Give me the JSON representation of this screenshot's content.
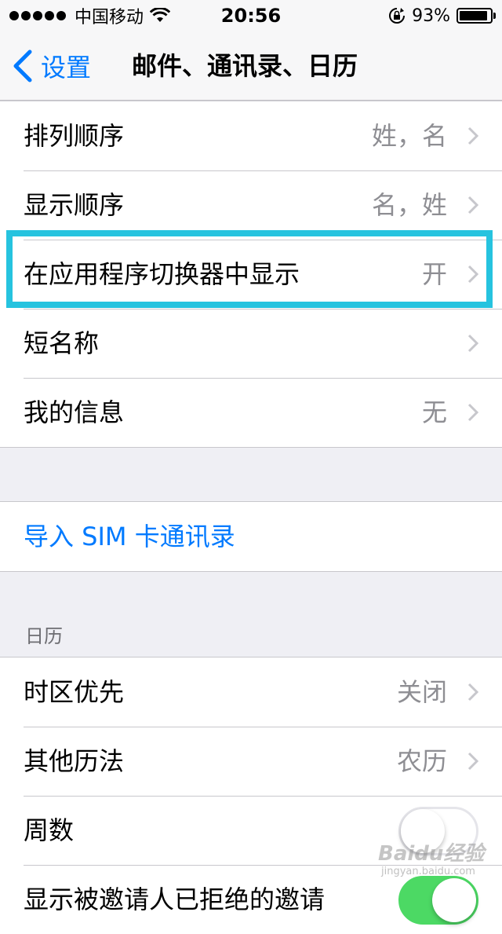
{
  "status_bar": {
    "carrier": "中国移动",
    "time": "20:56",
    "battery_percent": "93%",
    "battery_level": 0.93,
    "icons": [
      "signal-dots-icon",
      "wifi-icon",
      "rotation-lock-icon",
      "battery-icon"
    ]
  },
  "nav": {
    "back_label": "设置",
    "title": "邮件、通讯录、日历"
  },
  "contacts": {
    "rows": [
      {
        "label": "排列顺序",
        "value": "姓，名"
      },
      {
        "label": "显示顺序",
        "value": "名，姓"
      },
      {
        "label": "在应用程序切换器中显示",
        "value": "开"
      },
      {
        "label": "短名称",
        "value": ""
      },
      {
        "label": "我的信息",
        "value": "无"
      }
    ]
  },
  "import": {
    "label": "导入 SIM 卡通讯录"
  },
  "calendar": {
    "header": "日历",
    "rows": [
      {
        "label": "时区优先",
        "value": "关闭"
      },
      {
        "label": "其他历法",
        "value": "农历"
      },
      {
        "label": "周数",
        "toggle": false
      },
      {
        "label": "显示被邀请人已拒绝的邀请",
        "toggle": true
      }
    ]
  },
  "watermark": {
    "text": "Baidu经验",
    "sub": "jingyan.baidu.com"
  },
  "colors": {
    "accent": "#007aff",
    "highlight": "#26c3df",
    "toggle_on": "#4cd964",
    "background": "#efeff4"
  }
}
